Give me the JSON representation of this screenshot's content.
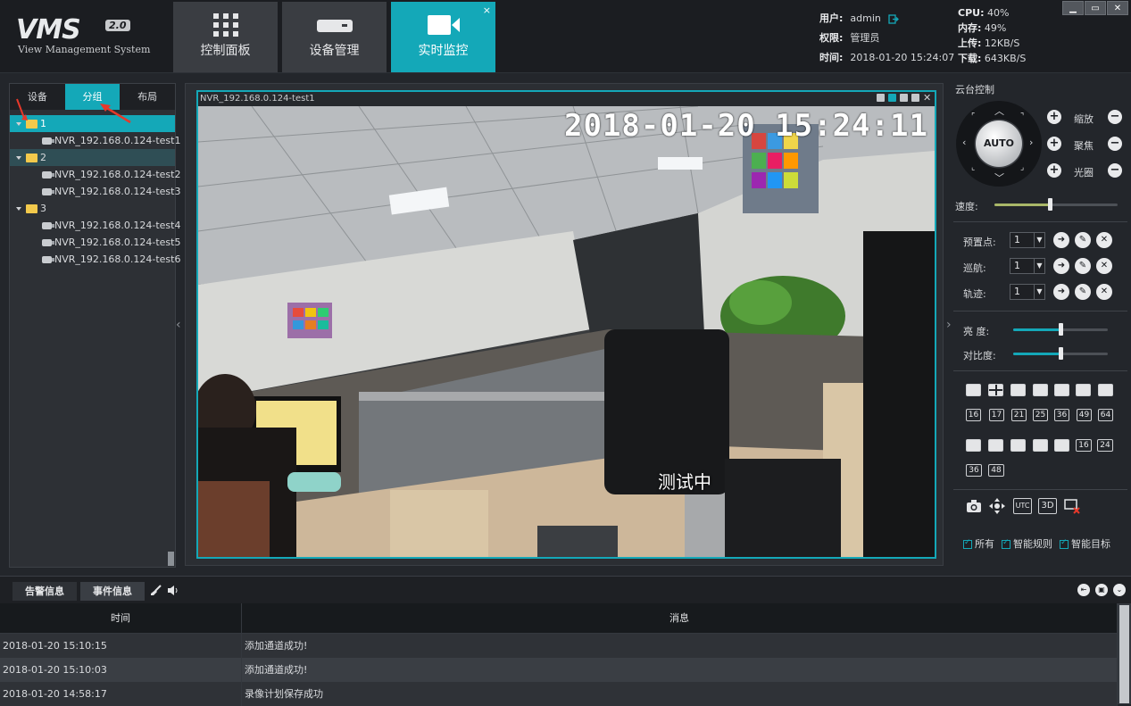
{
  "logo": {
    "title": "VMS",
    "version": "2.0",
    "subtitle": "View Management System"
  },
  "nav": {
    "tabs": [
      {
        "label": "控制面板",
        "icon": "grid-icon"
      },
      {
        "label": "设备管理",
        "icon": "device-icon"
      },
      {
        "label": "实时监控",
        "icon": "video-camera-icon",
        "close": "×"
      }
    ]
  },
  "user_info": {
    "user_label": "用户:",
    "user_value": "admin",
    "role_label": "权限:",
    "role_value": "管理员",
    "time_label": "时间:",
    "time_value": "2018-01-20 15:24:07"
  },
  "sys_stats": {
    "cpu_label": "CPU:",
    "cpu_value": "40%",
    "mem_label": "内存:",
    "mem_value": "49%",
    "up_label": "上传:",
    "up_value": "12KB/S",
    "down_label": "下载:",
    "down_value": "643KB/S"
  },
  "window_buttons": {
    "minimize": "▁",
    "restore": "▭",
    "close": "✕"
  },
  "left_panel": {
    "tabs": [
      "设备",
      "分组",
      "布局"
    ],
    "active_tab": "分组",
    "groups": [
      {
        "name": "1",
        "channels": [
          "NVR_192.168.0.124-test1"
        ]
      },
      {
        "name": "2",
        "channels": [
          "NVR_192.168.0.124-test2",
          "NVR_192.168.0.124-test3"
        ]
      },
      {
        "name": "3",
        "channels": [
          "NVR_192.168.0.124-test4",
          "NVR_192.168.0.124-test5",
          "NVR_192.168.0.124-test6"
        ]
      }
    ]
  },
  "video": {
    "title": "NVR_192.168.0.124-test1",
    "osd_time": "2018-01-20 15:24:11",
    "osd_text": "测试中"
  },
  "ptz": {
    "title": "云台控制",
    "auto_label": "AUTO",
    "zoom_label": "缩放",
    "focus_label": "聚焦",
    "iris_label": "光圈",
    "speed_label": "速度:",
    "speed_value": 0.55,
    "preset_label": "预置点:",
    "preset_value": "1",
    "cruise_label": "巡航:",
    "cruise_value": "1",
    "track_label": "轨迹:",
    "track_value": "1",
    "brightness_label": "亮  度:",
    "brightness_value": 0.5,
    "contrast_label": "对比度:",
    "contrast_value": 0.5
  },
  "layouts": {
    "row2_nums": [
      "16",
      "17",
      "21",
      "25",
      "36",
      "49",
      "64"
    ],
    "row3_nums": [
      "16",
      "24"
    ],
    "row4_nums": [
      "36",
      "48"
    ]
  },
  "tools": {
    "utc_label": "UTC",
    "3d_label": "3D"
  },
  "checkboxes": [
    "所有",
    "智能规则",
    "智能目标"
  ],
  "bottom": {
    "tabs": [
      "告警信息",
      "事件信息"
    ],
    "active_tab": "事件信息",
    "columns": [
      "时间",
      "消息"
    ],
    "rows": [
      {
        "time": "2018-01-20 15:10:15",
        "msg": "添加通道成功!"
      },
      {
        "time": "2018-01-20 15:10:03",
        "msg": "添加通道成功!"
      },
      {
        "time": "2018-01-20 14:58:17",
        "msg": "录像计划保存成功"
      }
    ]
  },
  "colors": {
    "accent": "#14a8b8",
    "annotation_red": "#e8382a"
  }
}
